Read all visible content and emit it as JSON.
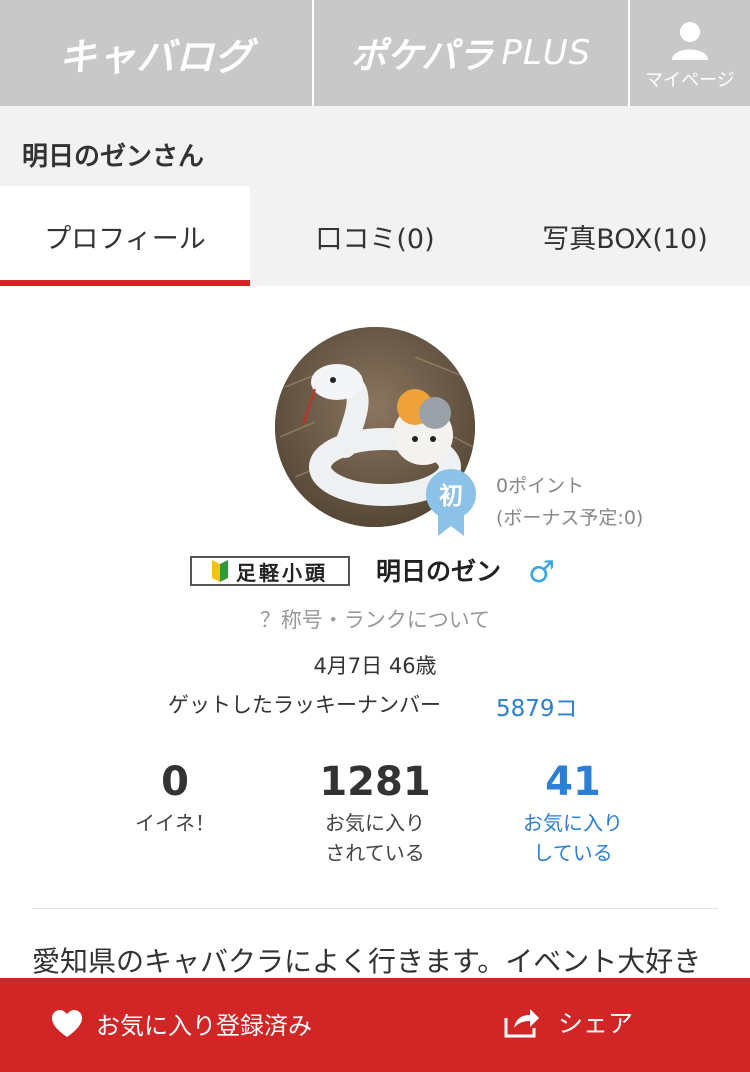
{
  "nav": {
    "brand1": "キャバログ",
    "brand2_main": "ポケパラ",
    "brand2_plus": "PLUS",
    "mypage": "マイページ"
  },
  "profile_header": {
    "username": "明日のゼンさん"
  },
  "tabs": [
    {
      "label": "プロフィール",
      "active": true
    },
    {
      "label": "口コミ(0)",
      "active": false
    },
    {
      "label": "写真BOX(10)",
      "active": false
    }
  ],
  "profile": {
    "badge_text": "初",
    "points": "0ポイント",
    "bonus": "(ボーナス予定:0)",
    "rank_title": "足軽小頭",
    "display_name": "明日のゼン",
    "gender_symbol": "♂",
    "rank_link": "？称号・ランクについて",
    "birth_age": "4月7日 46歳",
    "lucky_label": "ゲットしたラッキーナンバー",
    "lucky_count": "5879コ"
  },
  "stats": [
    {
      "value": "0",
      "label_line1": "イイネ！",
      "label_line2": ""
    },
    {
      "value": "1281",
      "label_line1": "お気に入り",
      "label_line2": "されている"
    },
    {
      "value": "41",
      "label_line1": "お気に入り",
      "label_line2": "している"
    }
  ],
  "bio": "愛知県のキャバクラによく行きます。イベント大好き",
  "actions": {
    "favorite": "お気に入り登録済み",
    "share": "シェア"
  },
  "colors": {
    "accent_red": "#d22526",
    "link_blue": "#2b7fd4",
    "nav_gray": "#c8c8c8"
  }
}
